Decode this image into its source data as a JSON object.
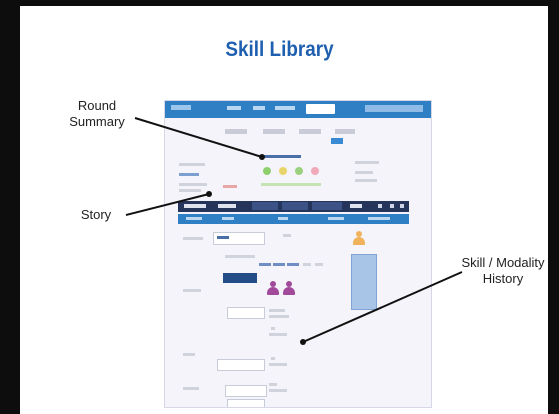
{
  "slide": {
    "title": "Skill Library"
  },
  "callouts": {
    "round_summary": "Round\nSummary",
    "story": "Story",
    "skill_modality_history": "Skill / Modality\nHistory"
  },
  "colors": {
    "title": "#1f5fb0",
    "nav": "#2f7fc4",
    "strip": "#24345a"
  }
}
